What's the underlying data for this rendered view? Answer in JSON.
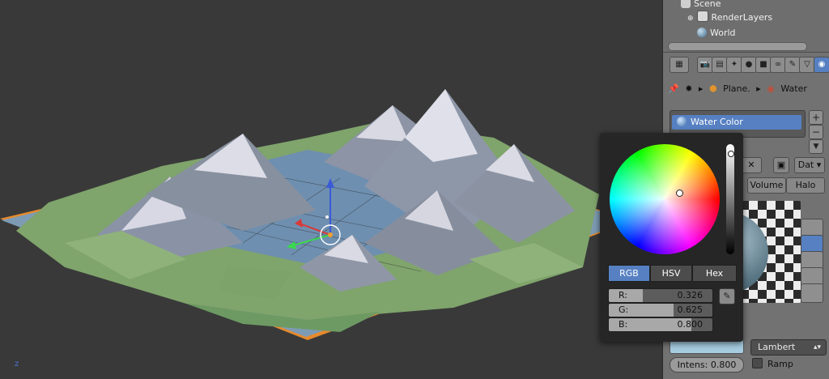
{
  "viewport": {
    "axis_label": "z"
  },
  "outliner": {
    "items": [
      {
        "label": "Scene",
        "icon": "scene-icon"
      },
      {
        "label": "RenderLayers",
        "icon": "render-layers-icon"
      },
      {
        "label": "World",
        "icon": "world-icon"
      }
    ]
  },
  "properties": {
    "breadcrumb": [
      "Plane.",
      "Water"
    ],
    "material_slot": "Water Color",
    "data_button": "Dat",
    "tabs": [
      "Volume",
      "Halo"
    ],
    "diffuse": {
      "color": "#a6cce0",
      "shader": "Lambert",
      "intensity_label": "Intens:",
      "intensity_value": "0.800",
      "ramp_label": "Ramp"
    }
  },
  "color_picker": {
    "modes": [
      "RGB",
      "HSV",
      "Hex"
    ],
    "active_mode": "RGB",
    "channels": [
      {
        "label": "R:",
        "value": "0.326",
        "fraction": 0.326
      },
      {
        "label": "G:",
        "value": "0.625",
        "fraction": 0.625
      },
      {
        "label": "B:",
        "value": "0.800",
        "fraction": 0.8
      }
    ],
    "current_color": "#5384cc"
  }
}
